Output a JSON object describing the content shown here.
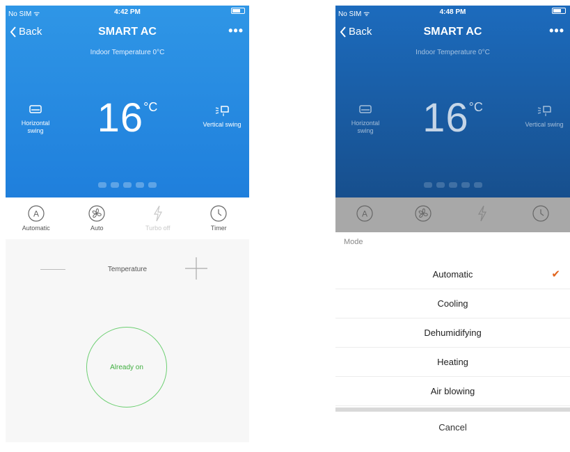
{
  "left_screen": {
    "status": {
      "carrier": "No SIM ᯤ",
      "time": "4:42 PM"
    },
    "nav": {
      "back": "Back",
      "title": "SMART AC",
      "more": "•••"
    },
    "indoor_temp": "Indoor Temperature 0°C",
    "set_temp": "16",
    "unit": "°C",
    "horizontal_swing": "Horizontal\nswing",
    "vertical_swing": "Vertical swing",
    "modes": [
      {
        "label": "Automatic",
        "icon": "a-mode-icon"
      },
      {
        "label": "Auto",
        "icon": "fan-icon"
      },
      {
        "label": "Turbo off",
        "icon": "lightning-icon"
      },
      {
        "label": "Timer",
        "icon": "clock-icon"
      }
    ],
    "temperature_label": "Temperature",
    "power_status": "Already on"
  },
  "right_screen": {
    "status": {
      "carrier": "No SIM ᯤ",
      "time": "4:48 PM"
    },
    "nav": {
      "back": "Back",
      "title": "SMART AC",
      "more": "•••"
    },
    "indoor_temp": "Indoor Temperature 0°C",
    "set_temp": "16",
    "unit": "°C",
    "horizontal_swing": "Horizontal\nswing",
    "vertical_swing": "Vertical swing",
    "sheet": {
      "title": "Mode",
      "options": [
        "Automatic",
        "Cooling",
        "Dehumidifying",
        "Heating",
        "Air blowing"
      ],
      "selected": "Automatic",
      "check": "✔",
      "cancel": "Cancel"
    }
  },
  "colors": {
    "blue": "#2f96e6",
    "dim_blue": "#1c6bbd",
    "accent_check": "#e2641d",
    "power_green": "#6dcf72"
  }
}
